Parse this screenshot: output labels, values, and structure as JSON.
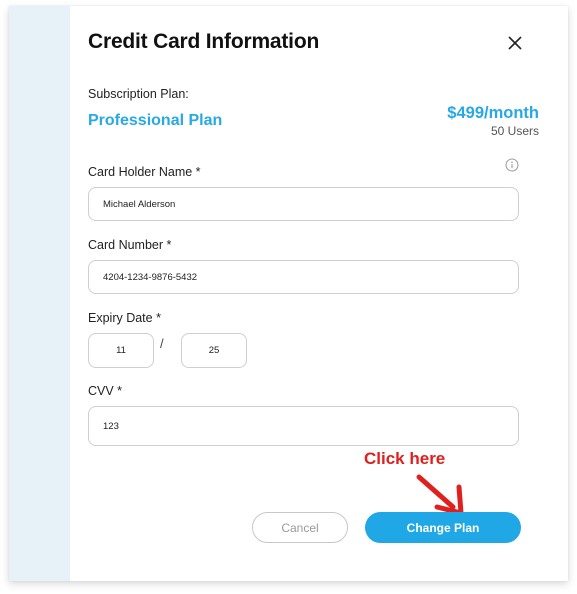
{
  "dialog": {
    "title": "Credit Card Information",
    "close_icon": "close-icon"
  },
  "subscription": {
    "label": "Subscription Plan:",
    "plan_name": "Professional Plan",
    "price": "$499/month",
    "users": "50 Users"
  },
  "form": {
    "card_holder": {
      "label": "Card Holder Name *",
      "value": "Michael Alderson",
      "info_icon": "info-icon"
    },
    "card_number": {
      "label": "Card Number *",
      "value": "4204-1234-9876-5432"
    },
    "expiry": {
      "label": "Expiry Date *",
      "month": "11",
      "separator": "/",
      "year": "25"
    },
    "cvv": {
      "label": "CVV *",
      "value": "123"
    }
  },
  "annotation": {
    "text": "Click here",
    "color": "#e0201e"
  },
  "actions": {
    "cancel_label": "Cancel",
    "primary_label": "Change Plan"
  },
  "colors": {
    "accent": "#20a7e5",
    "strip": "#e6f1f8"
  }
}
